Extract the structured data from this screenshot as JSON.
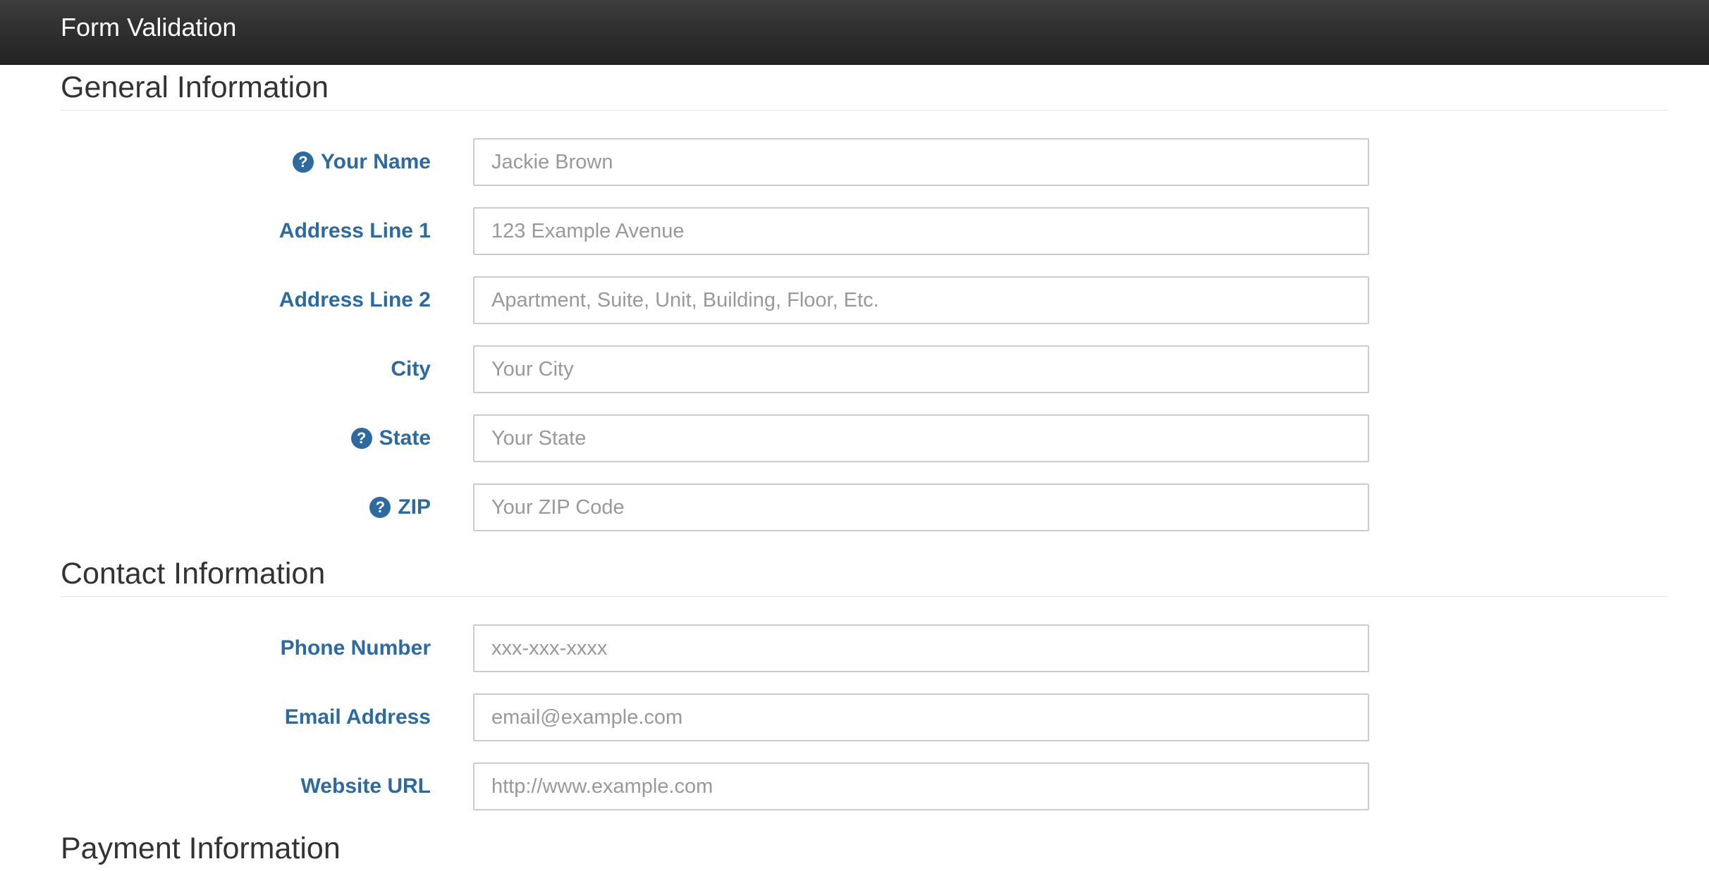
{
  "app": {
    "title": "Form Validation"
  },
  "sections": {
    "general": {
      "title": "General Information",
      "fields": {
        "name": {
          "label": "Your Name",
          "placeholder": "Jackie Brown",
          "value": "",
          "help_icon": "question-circle-icon"
        },
        "address1": {
          "label": "Address Line 1",
          "placeholder": "123 Example Avenue",
          "value": ""
        },
        "address2": {
          "label": "Address Line 2",
          "placeholder": "Apartment, Suite, Unit, Building, Floor, Etc.",
          "value": ""
        },
        "city": {
          "label": "City",
          "placeholder": "Your City",
          "value": ""
        },
        "state": {
          "label": "State",
          "placeholder": "Your State",
          "value": "",
          "help_icon": "question-circle-icon"
        },
        "zip": {
          "label": "ZIP",
          "placeholder": "Your ZIP Code",
          "value": "",
          "help_icon": "question-circle-icon"
        }
      }
    },
    "contact": {
      "title": "Contact Information",
      "fields": {
        "phone": {
          "label": "Phone Number",
          "placeholder": "xxx-xxx-xxxx",
          "value": ""
        },
        "email": {
          "label": "Email Address",
          "placeholder": "email@example.com",
          "value": ""
        },
        "website": {
          "label": "Website URL",
          "placeholder": "http://www.example.com",
          "value": ""
        }
      }
    },
    "next": {
      "title": "Payment Information"
    }
  },
  "icons": {
    "help_glyph": "?"
  },
  "colors": {
    "navbar": "#222222",
    "label": "#2c6aa0",
    "heading": "#333333",
    "placeholder": "#999999"
  }
}
